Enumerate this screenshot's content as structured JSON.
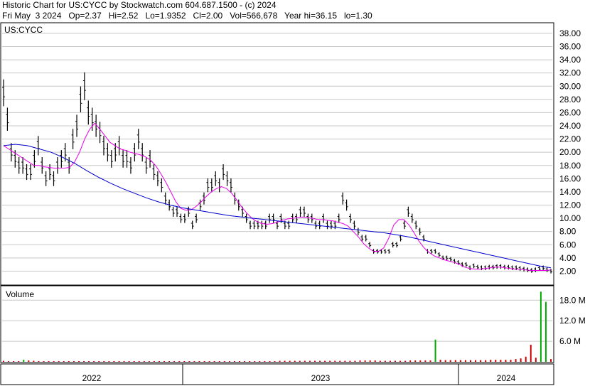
{
  "header": {
    "line1": "Historic Chart for US:CYCC by Stockwatch.com 604.687.1500 - (c) 2024",
    "line2": "Fri May  3 2024   Op=2.37   Hi=2.52   Lo=1.9352   Cl=2.00   Vol=566,678   Year hi=36.15   lo=1.30"
  },
  "colors": {
    "price": "#000000",
    "ma_short": "#e600e6",
    "ma_long": "#0000cc",
    "volume_down": "#cc0000",
    "volume_up": "#00aa00",
    "grid": "#c8c8c8"
  },
  "chart_data": [
    {
      "type": "line",
      "title": "US:CYCC",
      "x_labels": [
        "2022",
        "2023",
        "2024"
      ],
      "y_ticks": [
        "2.00",
        "4.00",
        "6.00",
        "8.00",
        "10.00",
        "12.00",
        "14.00",
        "16.00",
        "18.00",
        "20.00",
        "22.00",
        "24.00",
        "26.00",
        "28.00",
        "30.00",
        "32.00",
        "34.00",
        "36.00",
        "38.00"
      ],
      "ylim": [
        0,
        39.5
      ],
      "grid": true,
      "series": [
        {
          "role": "price",
          "style": "ohlc-bars",
          "values": [
            29,
            25,
            20,
            19,
            18,
            18,
            17,
            17,
            19,
            21,
            18,
            16,
            17,
            16,
            18,
            19,
            20,
            18,
            22,
            24,
            28,
            30,
            26,
            25,
            24,
            23,
            21,
            20,
            19,
            20,
            21,
            19,
            19,
            18,
            20,
            22,
            20,
            18,
            19,
            17,
            16,
            15,
            13,
            12,
            11,
            11,
            10,
            10,
            11,
            9,
            10,
            12,
            13,
            15,
            15,
            16,
            15,
            17,
            16,
            15,
            13,
            12,
            11,
            10,
            9,
            9,
            9,
            9,
            9,
            10,
            10,
            9,
            10,
            9,
            9,
            10,
            10,
            11,
            11,
            10,
            10,
            9,
            9,
            10,
            9,
            9,
            9,
            10,
            13,
            12,
            10,
            9,
            8,
            7,
            7,
            6,
            5,
            5,
            5,
            5,
            5,
            6,
            6,
            7,
            9,
            11,
            10,
            9,
            8,
            7,
            5,
            5,
            5,
            4.5,
            4,
            4,
            3.8,
            3.5,
            3.3,
            3,
            3,
            2.5,
            2.8,
            2.6,
            2.5,
            2.5,
            2.6,
            2.6,
            2.7,
            2.7,
            2.6,
            2.6,
            2.5,
            2.5,
            2.4,
            2.3,
            2.2,
            2.1,
            2.2,
            2.4,
            2.5,
            2.2,
            2
          ]
        },
        {
          "role": "ma_short",
          "values": [
            21,
            20.5,
            20,
            19.5,
            19,
            18.5,
            18,
            18,
            17.8,
            17.7,
            17.6,
            17.6,
            17.6,
            17.7,
            18.5,
            20,
            22,
            23.5,
            24.4,
            23.5,
            22.5,
            21.5,
            21,
            20.5,
            20.3,
            20,
            19.8,
            19.6,
            19.3,
            18.8,
            18,
            16.8,
            15.5,
            14,
            12.5,
            11.5,
            11.2,
            11.3,
            11.8,
            12.5,
            13.3,
            14,
            14.5,
            14.8,
            14.5,
            13.8,
            12.8,
            11.7,
            10.8,
            10,
            9.5,
            9.2,
            9.1,
            9.2,
            9.4,
            9.7,
            9.9,
            10,
            10.1,
            10.2,
            10.1,
            10,
            9.8,
            9.8,
            9.7,
            9.6,
            9.4,
            9.2,
            8.8,
            8,
            7.2,
            6.2,
            5.5,
            5,
            5,
            5.5,
            7,
            9,
            9.8,
            9.8,
            9,
            7.8,
            6.5,
            5.5,
            4.8,
            4.3,
            4,
            3.7,
            3.5,
            3.3,
            3,
            2.6,
            2.4,
            2.3,
            2.3,
            2.4,
            2.5,
            2.6,
            2.6,
            2.5,
            2.4,
            2.3,
            2.3,
            2.2,
            2.1,
            2.1,
            2.1,
            2.1,
            2.2
          ]
        },
        {
          "role": "ma_long",
          "values": [
            21,
            21.2,
            21,
            20.5,
            20,
            19.2,
            18.3,
            17.2,
            16.2,
            15.3,
            14.5,
            13.8,
            13.1,
            12.5,
            12,
            11.6,
            11.3,
            11,
            10.7,
            10.4,
            10.2,
            10,
            9.8,
            9.6,
            9.4,
            9.2,
            9,
            8.8,
            8.6,
            8.4,
            8.2,
            8,
            7.8,
            7.5,
            7.2,
            6.8,
            6.4,
            6,
            5.6,
            5.2,
            4.8,
            4.4,
            4,
            3.6,
            3.2,
            2.8,
            2.5
          ]
        }
      ]
    },
    {
      "type": "bar",
      "title": "Volume",
      "y_ticks": [
        "6.0 M",
        "12.0 M",
        "18.0 M"
      ],
      "ylim": [
        0,
        22
      ],
      "grid": true,
      "series": [
        {
          "name": "Volume",
          "values": [
            0.3,
            0.2,
            0.2,
            0.2,
            0.6,
            0.4,
            0.3,
            0.2,
            0.2,
            0.2,
            0.2,
            0.2,
            0.2,
            0.2,
            0.2,
            0.2,
            0.2,
            0.2,
            0.2,
            0.2,
            0.2,
            0.2,
            0.2,
            0.2,
            0.2,
            0.2,
            0.2,
            0.2,
            0.2,
            0.2,
            0.2,
            0.2,
            0.2,
            0.2,
            0.2,
            0.2,
            0.2,
            0.2,
            0.2,
            0.2,
            0.2,
            0.2,
            0.2,
            0.2,
            0.2,
            0.2,
            0.2,
            0.2,
            0.2,
            0.2,
            0.2,
            0.2,
            0.2,
            0.2,
            0.2,
            0.3,
            0.3,
            0.3,
            0.3,
            0.3,
            0.3,
            0.3,
            0.3,
            0.3,
            0.3,
            0.3,
            0.3,
            0.3,
            0.3,
            0.3,
            0.3,
            0.4,
            0.4,
            0.4,
            0.4,
            0.3,
            0.3,
            0.3,
            0.3,
            0.3,
            0.3,
            0.4,
            0.4,
            0.4,
            0.4,
            0.4,
            6.5,
            0.6,
            0.5,
            0.5,
            0.5,
            0.5,
            0.5,
            0.5,
            0.5,
            0.5,
            0.5,
            0.6,
            0.6,
            0.6,
            0.6,
            0.6,
            0.8,
            1,
            1.5,
            5,
            1.2,
            20.5,
            17.5,
            0.8
          ],
          "up_flags": [
            0,
            0,
            0,
            0,
            1,
            0,
            0,
            0,
            0,
            0,
            0,
            0,
            0,
            0,
            0,
            0,
            0,
            0,
            0,
            0,
            0,
            0,
            0,
            0,
            0,
            0,
            0,
            0,
            0,
            0,
            0,
            0,
            0,
            0,
            0,
            0,
            0,
            0,
            0,
            0,
            0,
            0,
            0,
            0,
            0,
            0,
            0,
            0,
            0,
            0,
            0,
            0,
            0,
            0,
            0,
            0,
            0,
            0,
            0,
            0,
            0,
            0,
            0,
            0,
            0,
            0,
            0,
            0,
            0,
            0,
            0,
            0,
            0,
            0,
            0,
            0,
            0,
            0,
            0,
            0,
            0,
            0,
            0,
            0,
            0,
            0,
            1,
            0,
            0,
            0,
            0,
            0,
            0,
            0,
            0,
            0,
            0,
            0,
            0,
            0,
            0,
            0,
            0,
            0,
            0,
            0,
            0,
            1,
            1,
            0
          ]
        }
      ]
    }
  ]
}
